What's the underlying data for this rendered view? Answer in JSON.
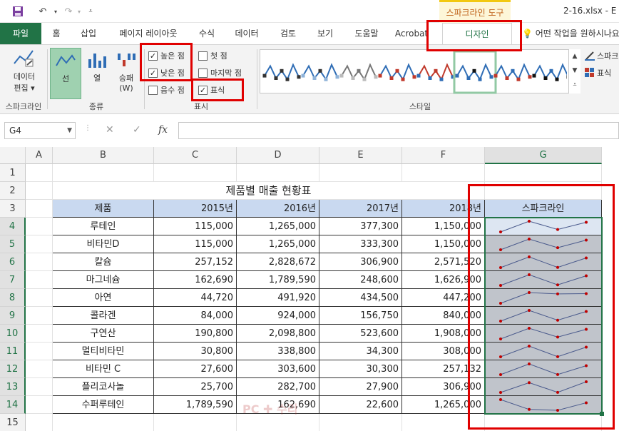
{
  "titlebar": {
    "context_group": "스파크라인 도구",
    "filename": "2-16.xlsx - E"
  },
  "tabs": [
    {
      "label": "파일"
    },
    {
      "label": "홈"
    },
    {
      "label": "삽입"
    },
    {
      "label": "페이지 레이아웃"
    },
    {
      "label": "수식"
    },
    {
      "label": "데이터"
    },
    {
      "label": "검토"
    },
    {
      "label": "보기"
    },
    {
      "label": "도움말"
    },
    {
      "label": "Acrobat"
    },
    {
      "label": "디자인"
    }
  ],
  "tell_me": "어떤 작업을 원하시나요",
  "ribbon": {
    "sparkline_group": {
      "edit_label_1": "데이터",
      "edit_label_2": "편집",
      "group_label": "스파크라인"
    },
    "type_group": {
      "line": "선",
      "column": "열",
      "winloss_1": "승패",
      "winloss_2": "(W)",
      "group_label": "종류"
    },
    "show_group": {
      "high_point": "높은 점",
      "low_point": "낮은 점",
      "negative_points": "음수 점",
      "first_point": "첫 점",
      "last_point": "마지막 점",
      "markers": "표식",
      "group_label": "표시"
    },
    "style_group": {
      "group_label": "스타일"
    },
    "right": {
      "sparkline_color": "스파크",
      "marker_color": "표식"
    }
  },
  "formula_bar": {
    "name_box": "G4",
    "fx": "fx",
    "cancel": "✕",
    "enter": "✓"
  },
  "columns": [
    "A",
    "B",
    "C",
    "D",
    "E",
    "F",
    "G"
  ],
  "rows": [
    "1",
    "2",
    "3",
    "4",
    "5",
    "6",
    "7",
    "8",
    "9",
    "10",
    "11",
    "12",
    "13",
    "14",
    "15"
  ],
  "sheet": {
    "title": "제품별 매출 현황표",
    "headers": [
      "제품",
      "2015년",
      "2016년",
      "2017년",
      "2018년",
      "스파크라인"
    ],
    "data": [
      [
        "루테인",
        "115,000",
        "1,265,000",
        "377,300",
        "1,150,000"
      ],
      [
        "비타민D",
        "115,000",
        "1,265,000",
        "333,300",
        "1,150,000"
      ],
      [
        "칼슘",
        "257,152",
        "2,828,672",
        "306,900",
        "2,571,520"
      ],
      [
        "마그네슘",
        "162,690",
        "1,789,590",
        "248,600",
        "1,626,900"
      ],
      [
        "아연",
        "44,720",
        "491,920",
        "434,500",
        "447,200"
      ],
      [
        "콜라겐",
        "84,000",
        "924,000",
        "156,750",
        "840,000"
      ],
      [
        "구연산",
        "190,800",
        "2,098,800",
        "523,600",
        "1,908,000"
      ],
      [
        "멀티비타민",
        "30,800",
        "338,800",
        "34,300",
        "308,000"
      ],
      [
        "비타민 C",
        "27,600",
        "303,600",
        "30,300",
        "257,132"
      ],
      [
        "플리코사놀",
        "25,700",
        "282,700",
        "27,900",
        "306,900"
      ],
      [
        "수퍼루테인",
        "1,789,590",
        "162,690",
        "22,600",
        "1,265,000"
      ]
    ],
    "sparks": [
      [
        115000,
        1265000,
        377300,
        1150000
      ],
      [
        115000,
        1265000,
        333300,
        1150000
      ],
      [
        257152,
        2828672,
        306900,
        2571520
      ],
      [
        162690,
        1789590,
        248600,
        1626900
      ],
      [
        44720,
        491920,
        434500,
        447200
      ],
      [
        84000,
        924000,
        156750,
        840000
      ],
      [
        190800,
        2098800,
        523600,
        1908000
      ],
      [
        30800,
        338800,
        34300,
        308000
      ],
      [
        27600,
        303600,
        30300,
        257132
      ],
      [
        25700,
        282700,
        27900,
        306900
      ],
      [
        1789590,
        162690,
        22600,
        1265000
      ]
    ]
  },
  "colors": {
    "excel_green": "#217346",
    "highlight_red": "#e00000",
    "spark_line": "#4a5a8c",
    "spark_marker": "#c00000"
  }
}
